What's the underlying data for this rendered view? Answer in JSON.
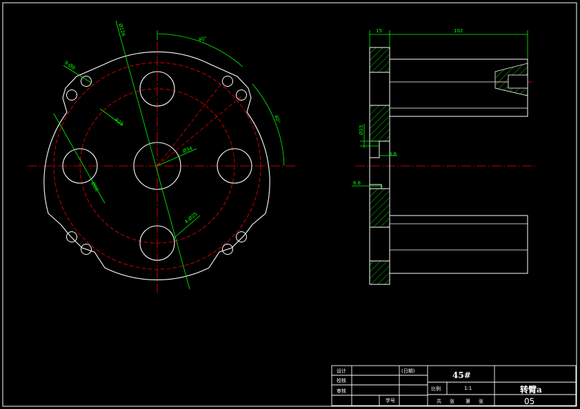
{
  "colors": {
    "background": "#000000",
    "outline": "#ffffff",
    "centerline": "#ff0000",
    "dimension": "#00ff00",
    "hatch": "#00ff00"
  },
  "front_view": {
    "dims": {
      "bolt_circle": "Ø126",
      "holes_top": "9-Ø8",
      "radius": "R25",
      "holes_bottom": "4-Ø25",
      "angle_top": "40°",
      "angle_right": "40°",
      "center_bore": "Ø34",
      "pitch_circle": "Ø88"
    }
  },
  "side_view": {
    "dims": {
      "thickness": "15",
      "length": "102",
      "slot_height": "Ø25",
      "slot_depth": "3.6",
      "groove": "6.8"
    }
  },
  "title_block": {
    "designer_label": "设计",
    "date_label": "(日期)",
    "checker_label": "校核",
    "reviewer_label": "审核",
    "student_no_label": "学号",
    "material": "45#",
    "scale_label": "比例",
    "scale_value": "1:1",
    "sheet_total": "共",
    "sheet_unit": "张",
    "sheet_no": "第",
    "sheet_unit2": "张",
    "part_name": "转臂a",
    "drawing_no": "05"
  }
}
